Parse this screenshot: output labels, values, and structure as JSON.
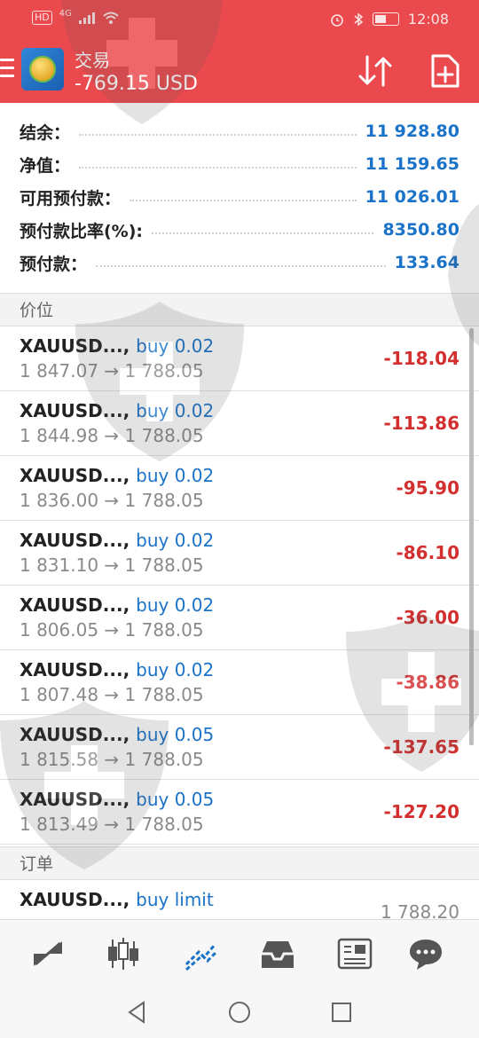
{
  "status_bar": {
    "hd": "HD",
    "net": "4G",
    "time": "12:08"
  },
  "header": {
    "title": "交易",
    "balance_change": "-769.15 USD",
    "colors": {
      "bar": "#ea4a4e"
    }
  },
  "summary": [
    {
      "label": "结余：",
      "value": "11 928.80"
    },
    {
      "label": "净值：",
      "value": "11 159.65"
    },
    {
      "label": "可用预付款：",
      "value": "11 026.01"
    },
    {
      "label": "预付款比率(%):",
      "value": "8350.80"
    },
    {
      "label": "预付款：",
      "value": "133.64"
    }
  ],
  "sections": {
    "positions": "价位",
    "orders": "订单"
  },
  "positions": [
    {
      "symbol": "XAUUSD...,",
      "side": "buy 0.02",
      "prices": "1 847.07 → 1 788.05",
      "profit": "-118.04"
    },
    {
      "symbol": "XAUUSD...,",
      "side": "buy 0.02",
      "prices": "1 844.98 → 1 788.05",
      "profit": "-113.86"
    },
    {
      "symbol": "XAUUSD...,",
      "side": "buy 0.02",
      "prices": "1 836.00 → 1 788.05",
      "profit": "-95.90"
    },
    {
      "symbol": "XAUUSD...,",
      "side": "buy 0.02",
      "prices": "1 831.10 → 1 788.05",
      "profit": "-86.10"
    },
    {
      "symbol": "XAUUSD...,",
      "side": "buy 0.02",
      "prices": "1 806.05 → 1 788.05",
      "profit": "-36.00"
    },
    {
      "symbol": "XAUUSD...,",
      "side": "buy 0.02",
      "prices": "1 807.48 → 1 788.05",
      "profit": "-38.86"
    },
    {
      "symbol": "XAUUSD...,",
      "side": "buy 0.05",
      "prices": "1 815.58 → 1 788.05",
      "profit": "-137.65"
    },
    {
      "symbol": "XAUUSD...,",
      "side": "buy 0.05",
      "prices": "1 813.49 → 1 788.05",
      "profit": "-127.20"
    }
  ],
  "orders": [
    {
      "symbol": "XAUUSD...,",
      "side": "buy limit",
      "price": "1 788.20"
    }
  ],
  "bottom_nav": [
    {
      "icon": "quotes-icon"
    },
    {
      "icon": "chart-icon"
    },
    {
      "icon": "trade-icon",
      "active": true
    },
    {
      "icon": "history-icon"
    },
    {
      "icon": "news-icon"
    },
    {
      "icon": "chat-icon"
    }
  ],
  "colors": {
    "accent": "#1a73c8",
    "loss": "#d32f2f",
    "nav_active": "#1a73c8"
  }
}
